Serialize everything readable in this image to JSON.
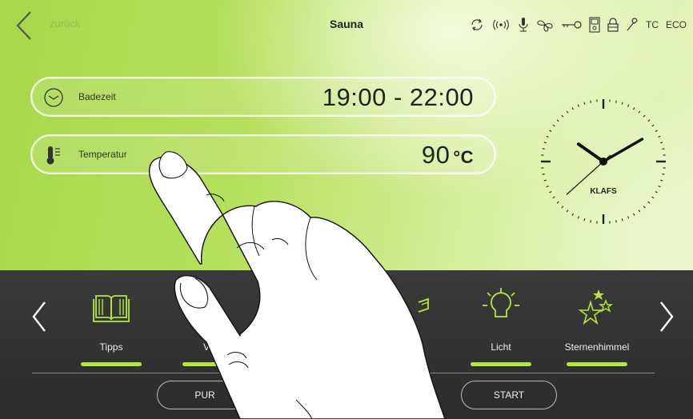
{
  "header": {
    "back_label": "zurück",
    "title": "Sauna",
    "status_icons": [
      "sync-icon",
      "wifi-icon",
      "microphone-icon",
      "fan-icon",
      "key-icon",
      "door-icon",
      "lock-icon",
      "wrench-icon"
    ],
    "status_texts": [
      "TC",
      "ECO"
    ]
  },
  "badezeit": {
    "label": "Badezeit",
    "value": "19:00 - 22:00"
  },
  "temperatur": {
    "label": "Temperatur",
    "value": "90",
    "unit": "°C"
  },
  "clock": {
    "brand": "KLAFS",
    "hour": 10,
    "minute": 10,
    "second": 38
  },
  "tiles": [
    {
      "label": "Tipps",
      "icon": "book-icon",
      "active": true
    },
    {
      "label": "Ve",
      "icon": "hidden",
      "active": true
    },
    {
      "label": "",
      "icon": "partial-icon",
      "active": false
    },
    {
      "label": "Licht",
      "icon": "lightbulb-icon",
      "active": true
    },
    {
      "label": "Sternenhimmel",
      "icon": "stars-icon",
      "active": true
    }
  ],
  "modes": {
    "pur": "PUR",
    "start": "START"
  },
  "colors": {
    "accent": "#b6e83c",
    "panel": "#2f2f2f",
    "background": "#b5e05c"
  }
}
